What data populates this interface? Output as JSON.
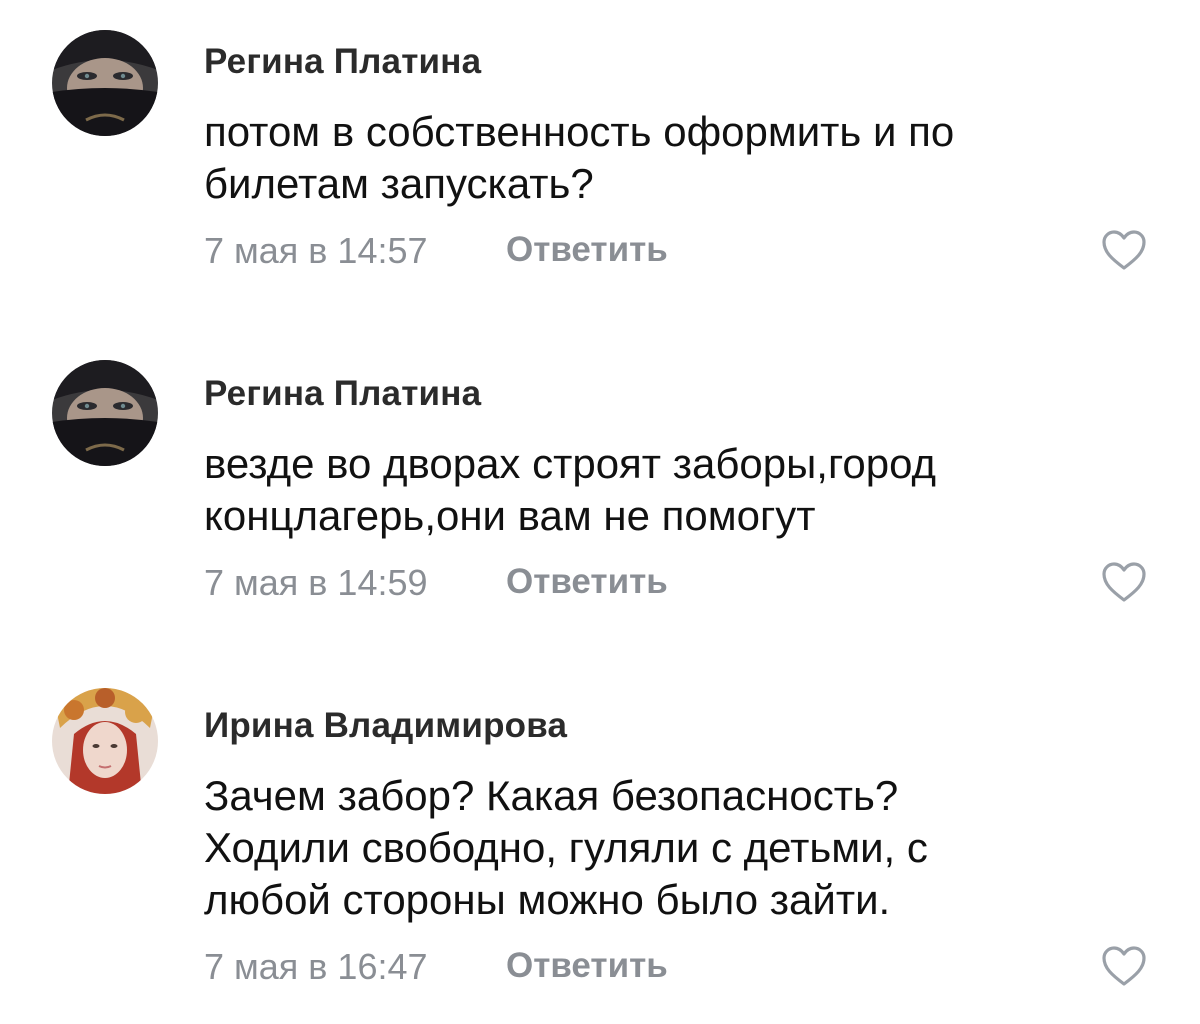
{
  "comments": [
    {
      "author": "Регина Платина",
      "avatar": "woman-with-black-veil-avatar",
      "lines": [
        "потом в собственность оформить и по",
        "билетам запускать?"
      ],
      "timestamp": "7 мая в 14:57",
      "reply_label": "Ответить",
      "like_icon": "heart-outline-icon"
    },
    {
      "author": "Регина Платина",
      "avatar": "woman-with-black-veil-avatar",
      "lines": [
        "везде во дворах строят заборы,город",
        "концлагерь,они вам не помогут"
      ],
      "timestamp": "7 мая в 14:59",
      "reply_label": "Ответить",
      "like_icon": "heart-outline-icon"
    },
    {
      "author": "Ирина Владимирова",
      "avatar": "red-haired-woman-autumn-leaves-avatar",
      "lines": [
        "Зачем забор? Какая безопасность?",
        "Ходили свободно, гуляли с детьми, с",
        "любой стороны можно было зайти."
      ],
      "timestamp": "7 мая в 16:47",
      "reply_label": "Ответить",
      "like_icon": "heart-outline-icon"
    }
  ],
  "colors": {
    "author": "#2b2b2b",
    "text": "#111111",
    "meta": "#8a8e94",
    "like_icon": "#9aa0a8"
  }
}
